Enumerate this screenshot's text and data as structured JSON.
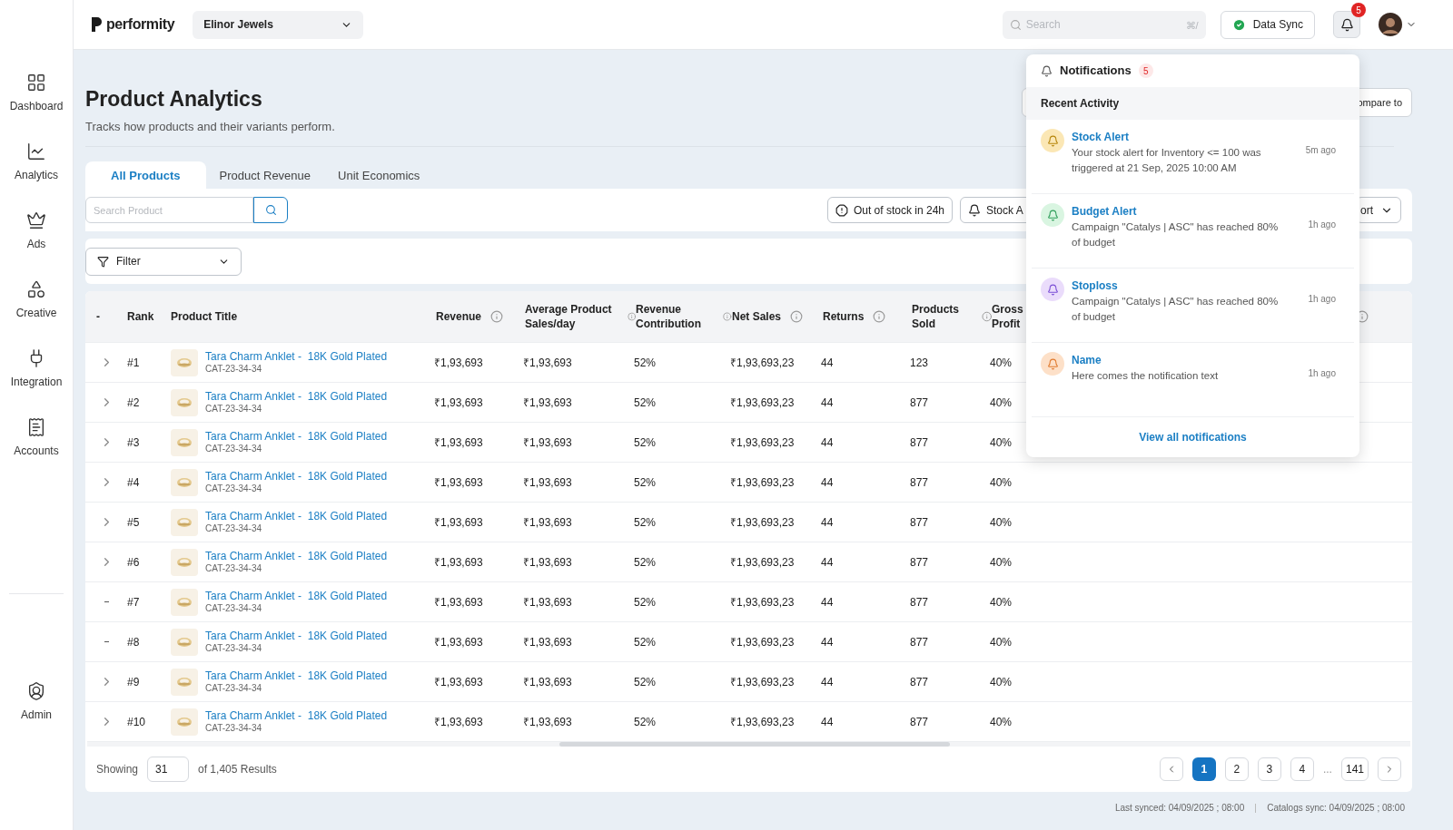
{
  "topbar": {
    "logo": "performity",
    "store": "Elinor Jewels",
    "search": {
      "placeholder": "Search",
      "shortcut": "⌘/"
    },
    "sync_button": "Data Sync",
    "notification_count": "5"
  },
  "sidebar": {
    "items": [
      {
        "label": "Dashboard"
      },
      {
        "label": "Analytics"
      },
      {
        "label": "Ads"
      },
      {
        "label": "Creative"
      },
      {
        "label": "Integration"
      },
      {
        "label": "Accounts"
      }
    ],
    "bottom": [
      {
        "label": "Admin"
      }
    ]
  },
  "page": {
    "title": "Product Analytics",
    "subtitle": "Tracks how products and their variants perform.",
    "compare_button": "ompare to"
  },
  "tabs": [
    {
      "label": "All Products",
      "selected": true
    },
    {
      "label": "Product Revenue",
      "selected": false
    },
    {
      "label": "Unit Economics",
      "selected": false
    }
  ],
  "toolbar": {
    "search_placeholder": "Search Product",
    "buttons": [
      "Out of stock in 24h",
      "Stock A"
    ],
    "sort_button": "ort"
  },
  "filter": {
    "label": "Filter"
  },
  "table": {
    "columns": [
      "-",
      "Rank",
      "Product Title",
      "Revenue",
      "Average Product Sales/day",
      "Revenue Contribution",
      "Net Sales",
      "Returns",
      "Products Sold",
      "Gross Profit"
    ],
    "rows": [
      {
        "expandable": true,
        "rank": "#1",
        "title": "Tara Charm Anklet -  18K Gold Plated",
        "sku": "CAT-23-34-34",
        "revenue": "₹1,93,693",
        "avg_sales": "₹1,93,693",
        "contribution": "52%",
        "net_sales": "₹1,93,693,23",
        "returns": "44",
        "sold": "123",
        "gross_profit": "40%"
      },
      {
        "expandable": true,
        "rank": "#2",
        "title": "Tara Charm Anklet -  18K Gold Plated",
        "sku": "CAT-23-34-34",
        "revenue": "₹1,93,693",
        "avg_sales": "₹1,93,693",
        "contribution": "52%",
        "net_sales": "₹1,93,693,23",
        "returns": "44",
        "sold": "877",
        "gross_profit": "40%"
      },
      {
        "expandable": true,
        "rank": "#3",
        "title": "Tara Charm Anklet -  18K Gold Plated",
        "sku": "CAT-23-34-34",
        "revenue": "₹1,93,693",
        "avg_sales": "₹1,93,693",
        "contribution": "52%",
        "net_sales": "₹1,93,693,23",
        "returns": "44",
        "sold": "877",
        "gross_profit": "40%"
      },
      {
        "expandable": true,
        "rank": "#4",
        "title": "Tara Charm Anklet -  18K Gold Plated",
        "sku": "CAT-23-34-34",
        "revenue": "₹1,93,693",
        "avg_sales": "₹1,93,693",
        "contribution": "52%",
        "net_sales": "₹1,93,693,23",
        "returns": "44",
        "sold": "877",
        "gross_profit": "40%"
      },
      {
        "expandable": true,
        "rank": "#5",
        "title": "Tara Charm Anklet -  18K Gold Plated",
        "sku": "CAT-23-34-34",
        "revenue": "₹1,93,693",
        "avg_sales": "₹1,93,693",
        "contribution": "52%",
        "net_sales": "₹1,93,693,23",
        "returns": "44",
        "sold": "877",
        "gross_profit": "40%"
      },
      {
        "expandable": true,
        "rank": "#6",
        "title": "Tara Charm Anklet -  18K Gold Plated",
        "sku": "CAT-23-34-34",
        "revenue": "₹1,93,693",
        "avg_sales": "₹1,93,693",
        "contribution": "52%",
        "net_sales": "₹1,93,693,23",
        "returns": "44",
        "sold": "877",
        "gross_profit": "40%"
      },
      {
        "expandable": false,
        "rank": "#7",
        "title": "Tara Charm Anklet -  18K Gold Plated",
        "sku": "CAT-23-34-34",
        "revenue": "₹1,93,693",
        "avg_sales": "₹1,93,693",
        "contribution": "52%",
        "net_sales": "₹1,93,693,23",
        "returns": "44",
        "sold": "877",
        "gross_profit": "40%"
      },
      {
        "expandable": false,
        "rank": "#8",
        "title": "Tara Charm Anklet -  18K Gold Plated",
        "sku": "CAT-23-34-34",
        "revenue": "₹1,93,693",
        "avg_sales": "₹1,93,693",
        "contribution": "52%",
        "net_sales": "₹1,93,693,23",
        "returns": "44",
        "sold": "877",
        "gross_profit": "40%"
      },
      {
        "expandable": true,
        "rank": "#9",
        "title": "Tara Charm Anklet -  18K Gold Plated",
        "sku": "CAT-23-34-34",
        "revenue": "₹1,93,693",
        "avg_sales": "₹1,93,693",
        "contribution": "52%",
        "net_sales": "₹1,93,693,23",
        "returns": "44",
        "sold": "877",
        "gross_profit": "40%"
      },
      {
        "expandable": true,
        "rank": "#10",
        "title": "Tara Charm Anklet -  18K Gold Plated",
        "sku": "CAT-23-34-34",
        "revenue": "₹1,93,693",
        "avg_sales": "₹1,93,693",
        "contribution": "52%",
        "net_sales": "₹1,93,693,23",
        "returns": "44",
        "sold": "877",
        "gross_profit": "40%"
      }
    ]
  },
  "pagination": {
    "showing_label": "Showing",
    "page_size": "31",
    "results": "of 1,405 Results",
    "pages": [
      {
        "label": "1",
        "selected": true
      },
      {
        "label": "2",
        "selected": false
      },
      {
        "label": "3",
        "selected": false
      },
      {
        "label": "4",
        "selected": false
      },
      {
        "label": "...",
        "kind": "gap",
        "selected": false
      },
      {
        "label": "141",
        "selected": false
      }
    ]
  },
  "status": {
    "last_synced": "Last synced: 04/09/2025 ; 08:00",
    "catalogs_sync": "Catalogs sync: 04/09/2025 ; 08:00"
  },
  "notifications": {
    "title": "Notifications",
    "count": "5",
    "section": "Recent Activity",
    "items": [
      {
        "title": "Stock Alert",
        "text": "Your stock alert for Inventory <= 100 was triggered at 21 Sep, 2025  10:00 AM",
        "time": "5m ago",
        "color": "#fbe7b5"
      },
      {
        "title": "Budget Alert",
        "text": "Campaign \"Catalys | ASC\" has reached 80% of budget",
        "time": "1h ago",
        "color": "#d9f5e1"
      },
      {
        "title": "Stoploss",
        "text": "Campaign \"Catalys | ASC\" has reached 80% of budget",
        "time": "1h ago",
        "color": "#eadcfb"
      },
      {
        "title": "Name",
        "text": "Here comes the notification text",
        "time": "1h ago",
        "color": "#fde0c8"
      }
    ],
    "footer_link": "View all notifications"
  }
}
